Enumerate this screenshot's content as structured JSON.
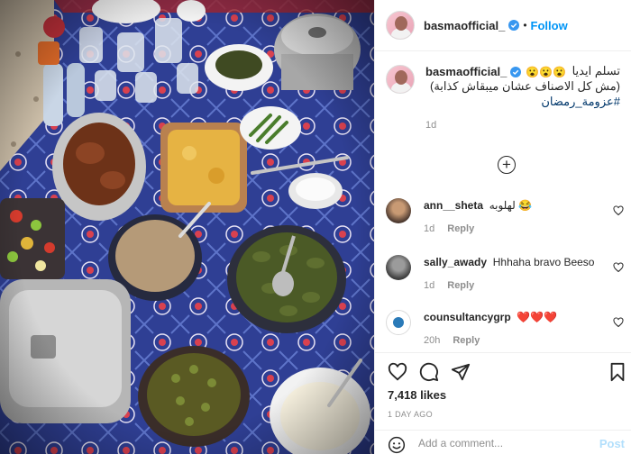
{
  "post": {
    "author": "basmaofficial_",
    "follow_label": "Follow",
    "separator": "•",
    "caption": {
      "emoji": "😮😮😮",
      "text_line1": "تسلم ايديا",
      "text_line2": "(مش كل الاصناف عشان ميبقاش كذابة)",
      "hashtag": "#عزومة_رمضان",
      "time": "1d"
    },
    "load_more_symbol": "+",
    "comments": [
      {
        "user": "ann__sheta",
        "text": "لهلوبه 😂",
        "time": "1d",
        "reply_label": "Reply"
      },
      {
        "user": "sally_awady",
        "text": "Hhhaha bravo Beeso",
        "time": "1d",
        "reply_label": "Reply"
      },
      {
        "user": "counsultancygrp",
        "text": "❤️❤️❤️",
        "time": "20h",
        "reply_label": "Reply"
      }
    ],
    "likes": "7,418 likes",
    "date": "1 DAY AGO",
    "add_comment_placeholder": "Add a comment...",
    "post_label": "Post"
  },
  "icons": {
    "verified": "verified-badge-icon",
    "heart": "heart-icon",
    "comment": "comment-icon",
    "share": "share-icon",
    "save": "bookmark-icon",
    "emoji": "emoji-icon",
    "load_more": "plus-circle-icon"
  },
  "colors": {
    "accent": "#0095f6",
    "hashtag": "#00376b",
    "muted": "#8e8e8e",
    "post_disabled": "#b2dffc",
    "tablecloth": "#2b3d8f"
  }
}
